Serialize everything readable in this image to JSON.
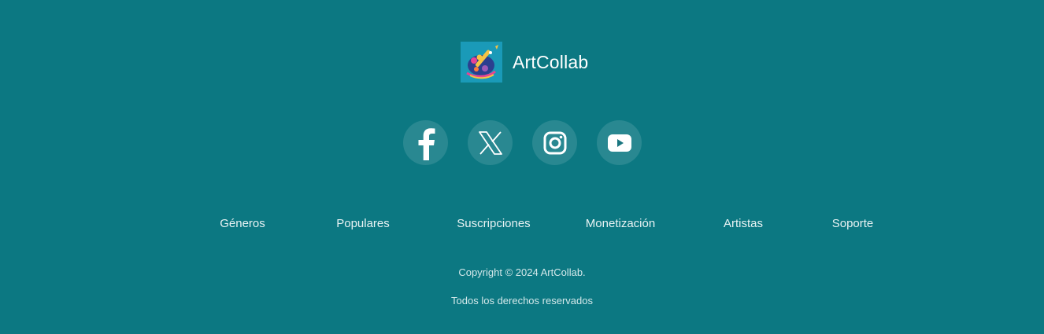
{
  "brand": {
    "name": "ArtCollab",
    "logo_icon": "paint-brush-palette-logo"
  },
  "social": [
    {
      "name": "Facebook",
      "icon": "facebook-icon"
    },
    {
      "name": "X",
      "icon": "x-icon"
    },
    {
      "name": "Instagram",
      "icon": "instagram-icon"
    },
    {
      "name": "YouTube",
      "icon": "youtube-icon"
    }
  ],
  "nav": {
    "items": [
      "Géneros",
      "Populares",
      "Suscripciones",
      "Monetización",
      "Artistas",
      "Soporte"
    ]
  },
  "footer": {
    "copyright": "Copyright © 2024 ArtCollab.",
    "rights": "Todos los derechos reservados"
  },
  "colors": {
    "background": "#0c7882",
    "social_circle": "rgba(255,255,255,0.12)",
    "text": "#ffffff"
  }
}
